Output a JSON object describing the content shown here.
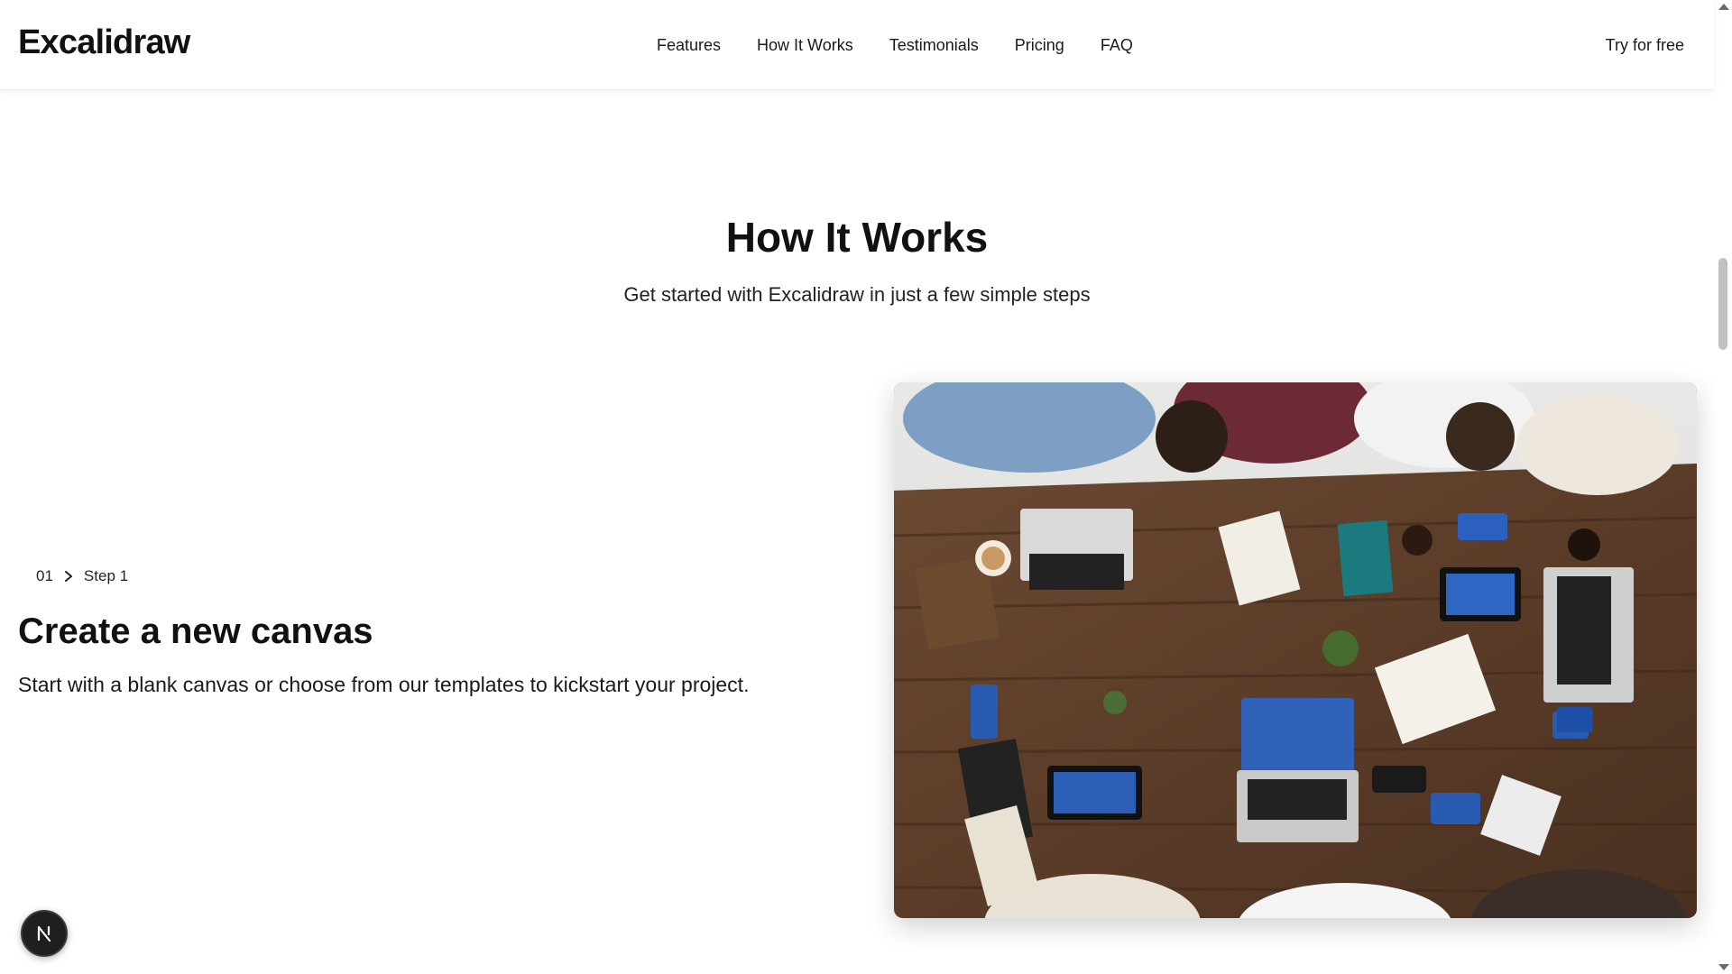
{
  "header": {
    "logo": "Excalidraw",
    "nav": [
      "Features",
      "How It Works",
      "Testimonials",
      "Pricing",
      "FAQ"
    ],
    "cta": "Try for free"
  },
  "section": {
    "title": "How It Works",
    "subtitle": "Get started with Excalidraw in just a few simple steps"
  },
  "step": {
    "number": "01",
    "label": "Step 1",
    "title": "Create a new canvas",
    "description": "Start with a blank canvas or choose from our templates to kickstart your project.",
    "image_alt": "Team collaborating around a wooden table with laptops and tablets"
  },
  "badge": {
    "letter": "N",
    "icon": "nextjs-icon"
  },
  "colors": {
    "text": "#111111",
    "badge_bg": "#1f1f1f",
    "scroll_thumb": "#c1c1c1"
  }
}
